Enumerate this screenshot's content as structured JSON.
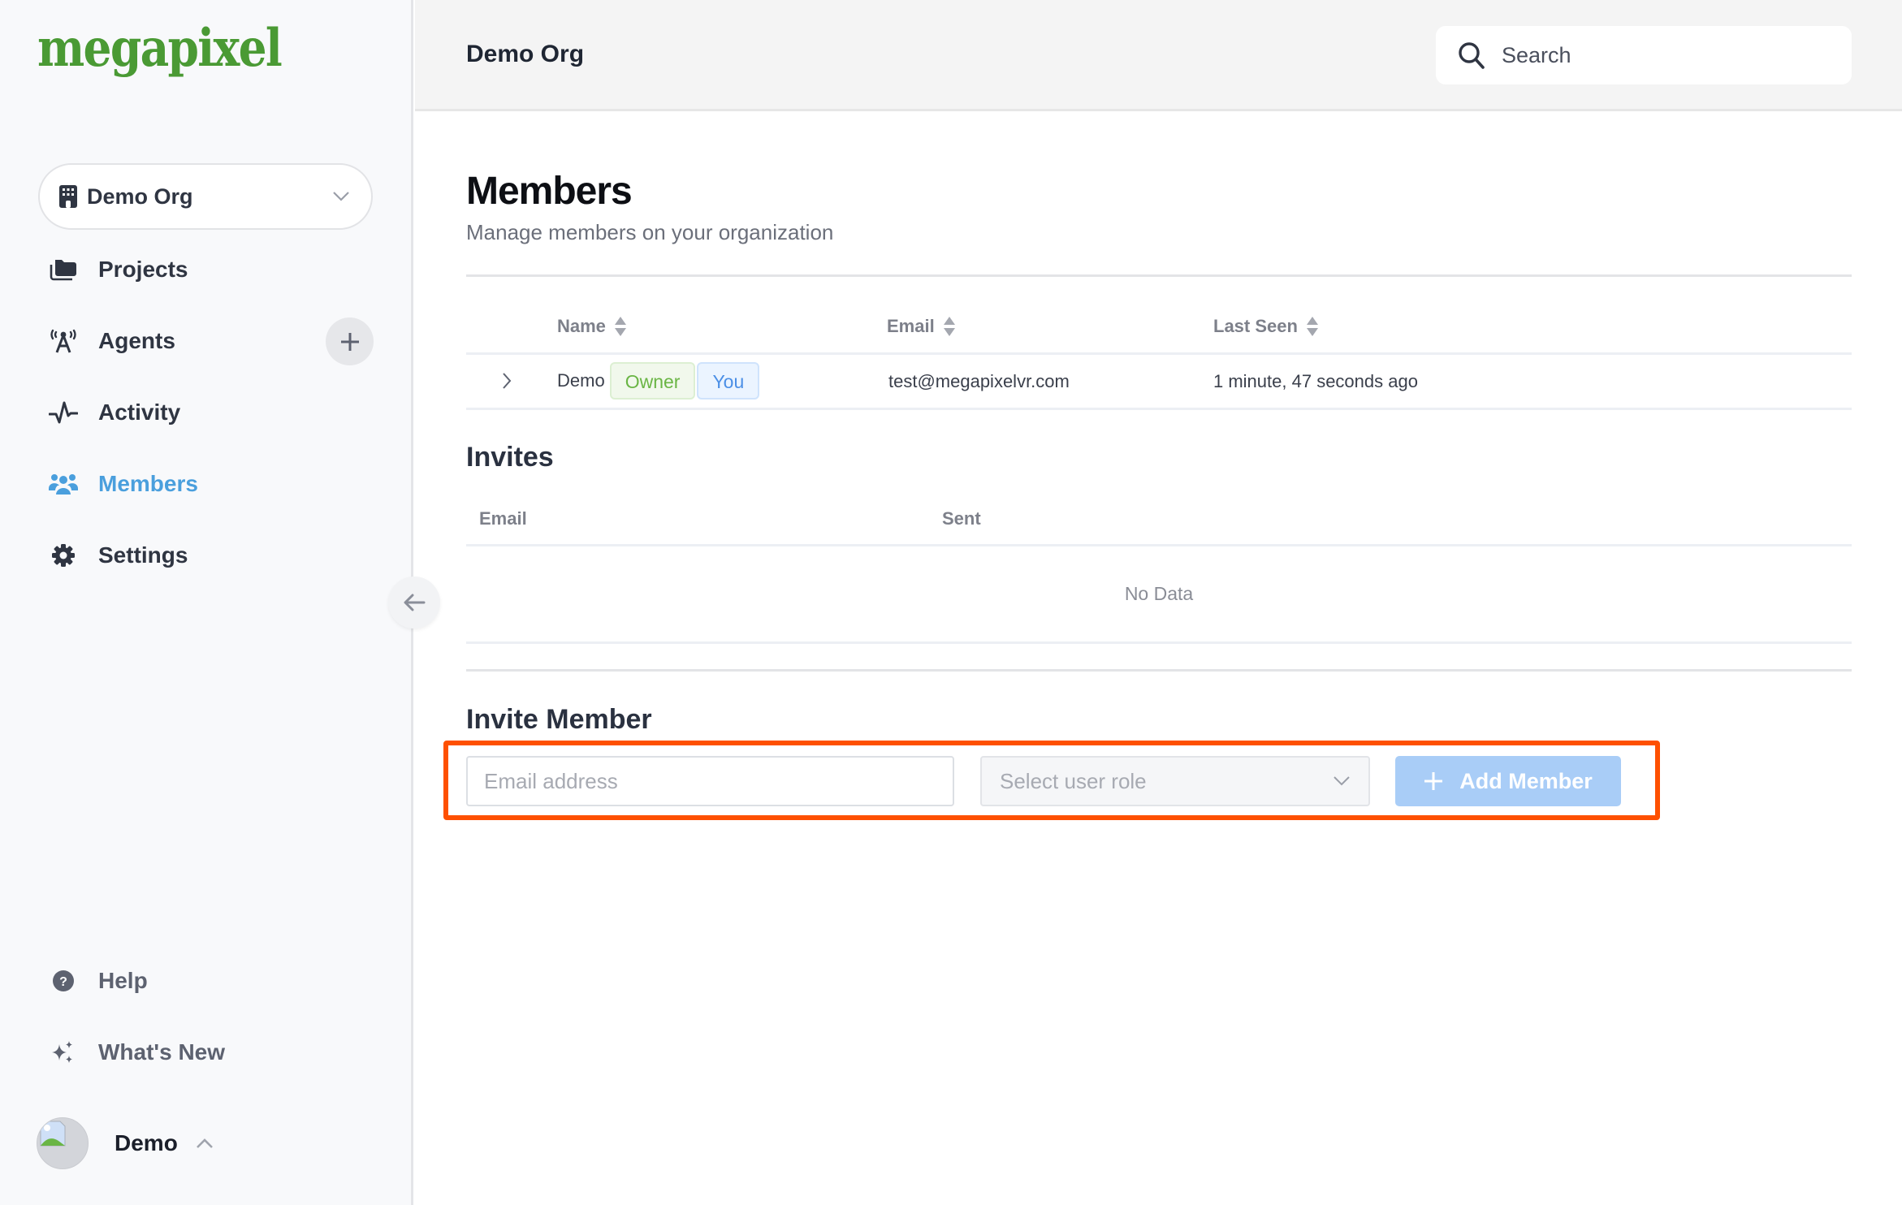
{
  "brand": {
    "logo_text": "megapixel",
    "logo_color": "#4a9a34"
  },
  "sidebar": {
    "org_selector": {
      "value": "Demo Org",
      "icon": "building-icon"
    },
    "items": [
      {
        "label": "Projects",
        "icon": "folder-icon",
        "active": false
      },
      {
        "label": "Agents",
        "icon": "antenna-icon",
        "active": false
      },
      {
        "label": "Activity",
        "icon": "pulse-icon",
        "active": false
      },
      {
        "label": "Members",
        "icon": "users-icon",
        "active": true
      },
      {
        "label": "Settings",
        "icon": "gear-icon",
        "active": false
      }
    ],
    "footer_items": [
      {
        "label": "Help",
        "icon": "help-circle-icon"
      },
      {
        "label": "What's New",
        "icon": "sparkles-icon"
      }
    ],
    "user": {
      "name": "Demo"
    },
    "accent_color": "#4a9fdd"
  },
  "header": {
    "title": "Demo Org",
    "search": {
      "placeholder": "Search"
    }
  },
  "page": {
    "title": "Members",
    "subtitle": "Manage members on your organization"
  },
  "members_table": {
    "columns": [
      "Name",
      "Email",
      "Last Seen"
    ],
    "rows": [
      {
        "name": "Demo",
        "badges": [
          "Owner",
          "You"
        ],
        "email": "test@megapixelvr.com",
        "last_seen": "1 minute, 47 seconds ago"
      }
    ]
  },
  "invites": {
    "title": "Invites",
    "columns": [
      "Email",
      "Sent"
    ],
    "empty_text": "No Data"
  },
  "invite_member": {
    "title": "Invite Member",
    "email_placeholder": "Email address",
    "email_value": "",
    "role_placeholder": "Select user role",
    "add_button_label": "Add Member",
    "highlight_color": "#fe5000"
  }
}
